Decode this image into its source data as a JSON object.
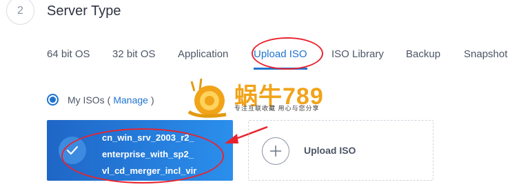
{
  "section": {
    "step_number": "2",
    "title": "Server Type"
  },
  "tabs": [
    {
      "label": "64 bit OS",
      "active": false
    },
    {
      "label": "32 bit OS",
      "active": false
    },
    {
      "label": "Application",
      "active": false
    },
    {
      "label": "Upload ISO",
      "active": true
    },
    {
      "label": "ISO Library",
      "active": false
    },
    {
      "label": "Backup",
      "active": false
    },
    {
      "label": "Snapshot",
      "active": false
    }
  ],
  "isos": {
    "radio_label": "My ISOs",
    "paren_open": "(",
    "manage_link": "Manage",
    "paren_close": ")",
    "selected": true,
    "selected_iso_name": "cn_win_srv_2003_r2_\nenterprise_with_sp2_\nvl_cd_merger_incl_vir"
  },
  "upload": {
    "label": "Upload ISO"
  },
  "watermark": {
    "brand": "蜗牛789",
    "tagline": "专注互联收藏  用心与您分享"
  },
  "colors": {
    "accent": "#1e73cf",
    "card_gradient_start": "#1f66c6",
    "card_gradient_end": "#2b8fec",
    "annotation": "#e8232f",
    "watermark": "#f1a319"
  },
  "icons": {
    "check": "check-icon",
    "plus": "plus-icon",
    "arrow": "arrow-annotation"
  }
}
